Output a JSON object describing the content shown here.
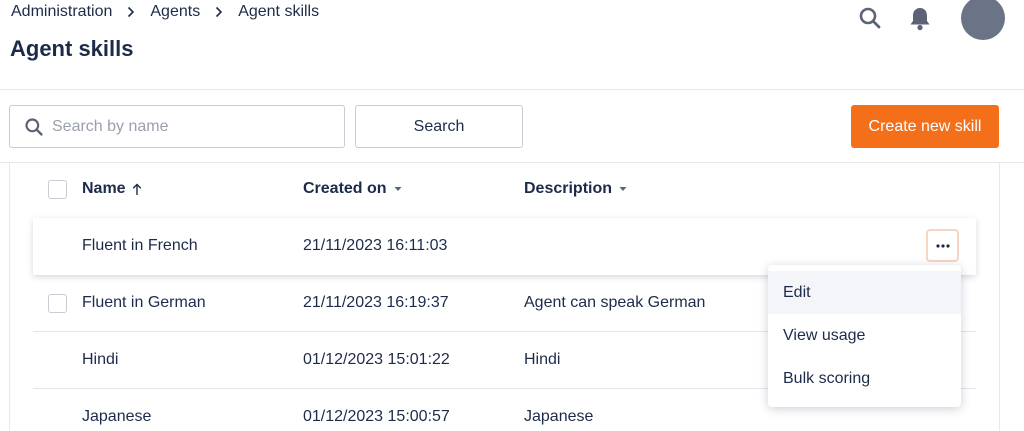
{
  "breadcrumb": [
    "Administration",
    "Agents",
    "Agent skills"
  ],
  "page_title": "Agent skills",
  "toolbar": {
    "search_placeholder": "Search by name",
    "search_label": "Search",
    "create_label": "Create new skill"
  },
  "table": {
    "columns": [
      {
        "label": "Name",
        "sort": "ascending"
      },
      {
        "label": "Created on",
        "sort": "dropdown"
      },
      {
        "label": "Description",
        "sort": "dropdown"
      }
    ],
    "rows": [
      {
        "name": "Fluent in French",
        "created": "21/11/2023 16:11:03",
        "description": ""
      },
      {
        "name": "Fluent in German",
        "created": "21/11/2023 16:19:37",
        "description": "Agent can speak German"
      },
      {
        "name": "Hindi",
        "created": "01/12/2023 15:01:22",
        "description": "Hindi"
      },
      {
        "name": "Japanese",
        "created": "01/12/2023 15:00:57",
        "description": "Japanese"
      }
    ]
  },
  "row_menu": {
    "items": [
      "Edit",
      "View usage",
      "Bulk scoring"
    ]
  },
  "colors": {
    "accent": "#f36f1a",
    "text": "#1d2b4a",
    "avatar": "#6b7387"
  },
  "icons": [
    "search-icon",
    "bell-icon",
    "chevron-right-icon",
    "sort-up-arrow-icon",
    "caret-down-icon",
    "more-dots-icon"
  ]
}
